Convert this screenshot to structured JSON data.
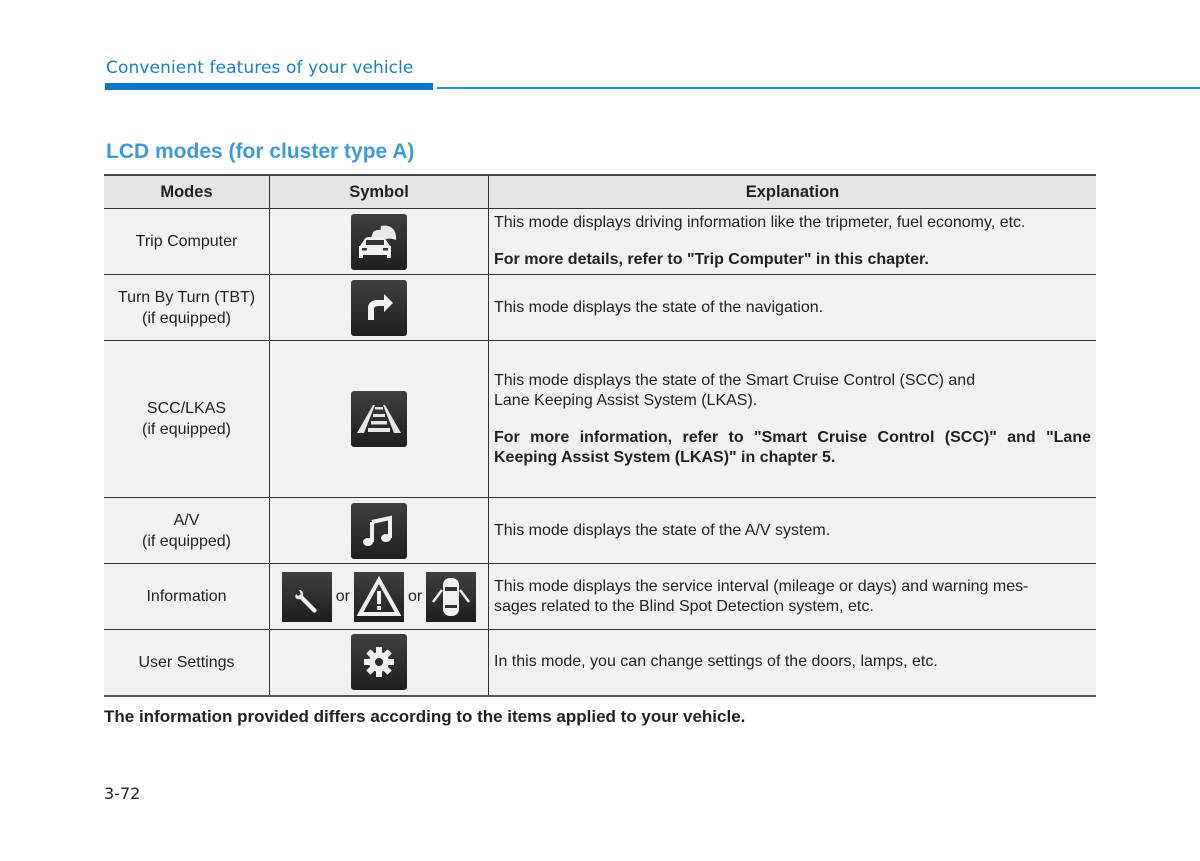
{
  "header": {
    "section": "Convenient features of your vehicle",
    "accent_color": "#0f76c1"
  },
  "title": "LCD modes (for cluster type A)",
  "table": {
    "columns": [
      "Modes",
      "Symbol",
      "Explanation"
    ],
    "rows": [
      {
        "mode": "Trip Computer",
        "mode_sub": "",
        "icons": [
          "car-leaf-icon"
        ],
        "explanation": "This mode displays driving information like the tripmeter, fuel economy, etc.",
        "note": "For more details, refer to \"Trip Computer\" in this chapter."
      },
      {
        "mode": "Turn By Turn (TBT)",
        "mode_sub": "(if equipped)",
        "icons": [
          "turn-right-arrow-icon"
        ],
        "explanation": "This mode displays the state of the navigation.",
        "note": ""
      },
      {
        "mode": "SCC/LKAS",
        "mode_sub": "(if equipped)",
        "icons": [
          "lane-icon"
        ],
        "explanation": "This mode displays the state of the Smart Cruise Control (SCC) and Lane Keeping Assist System (LKAS).",
        "explanation_line1": "This mode displays the state of the Smart Cruise Control (SCC) and",
        "explanation_line2": "Lane Keeping Assist System (LKAS).",
        "note": "For more information, refer to \"Smart Cruise Control (SCC)\" and \"Lane Keeping Assist System (LKAS)\" in chapter 5."
      },
      {
        "mode": "A/V",
        "mode_sub": "(if equipped)",
        "icons": [
          "music-note-icon"
        ],
        "explanation": "This mode displays the state of the A/V system.",
        "note": ""
      },
      {
        "mode": "Information",
        "mode_sub": "",
        "icons": [
          "wrench-icon",
          "warning-triangle-icon",
          "car-doors-open-icon"
        ],
        "icon_separator": "or",
        "explanation": "This mode displays the service interval (mileage or days) and warning messages related to the Blind Spot Detection system, etc.",
        "explanation_line1": "This mode displays the service interval (mileage or days) and warning mes-",
        "explanation_line2": "sages related to the Blind Spot Detection system, etc.",
        "note": ""
      },
      {
        "mode": "User Settings",
        "mode_sub": "",
        "icons": [
          "gear-icon"
        ],
        "explanation": "In this mode, you can change settings of the doors, lamps, etc.",
        "note": ""
      }
    ]
  },
  "footnote": "The information provided differs according to the items applied to your vehicle.",
  "page_number": "3-72"
}
